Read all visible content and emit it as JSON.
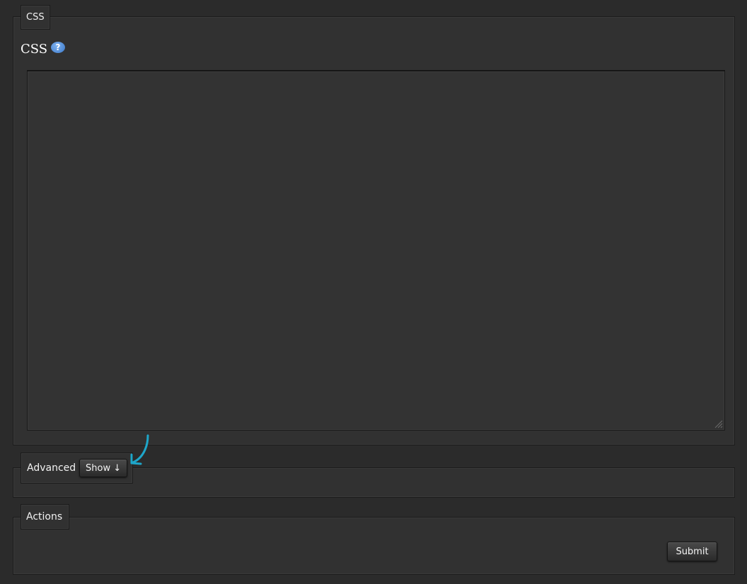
{
  "css_section": {
    "legend": "CSS",
    "heading": "CSS",
    "help_icon": "question-icon",
    "help_glyph": "?",
    "textarea_value": ""
  },
  "advanced_section": {
    "legend": "Advanced",
    "show_button": "Show ↓"
  },
  "actions_section": {
    "legend": "Actions",
    "submit_button": "Submit"
  },
  "colors": {
    "background": "#2b2b2b",
    "panel": "#313131",
    "help_icon": "#4a8ad8",
    "annotation_arrow": "#1ea6c9"
  }
}
